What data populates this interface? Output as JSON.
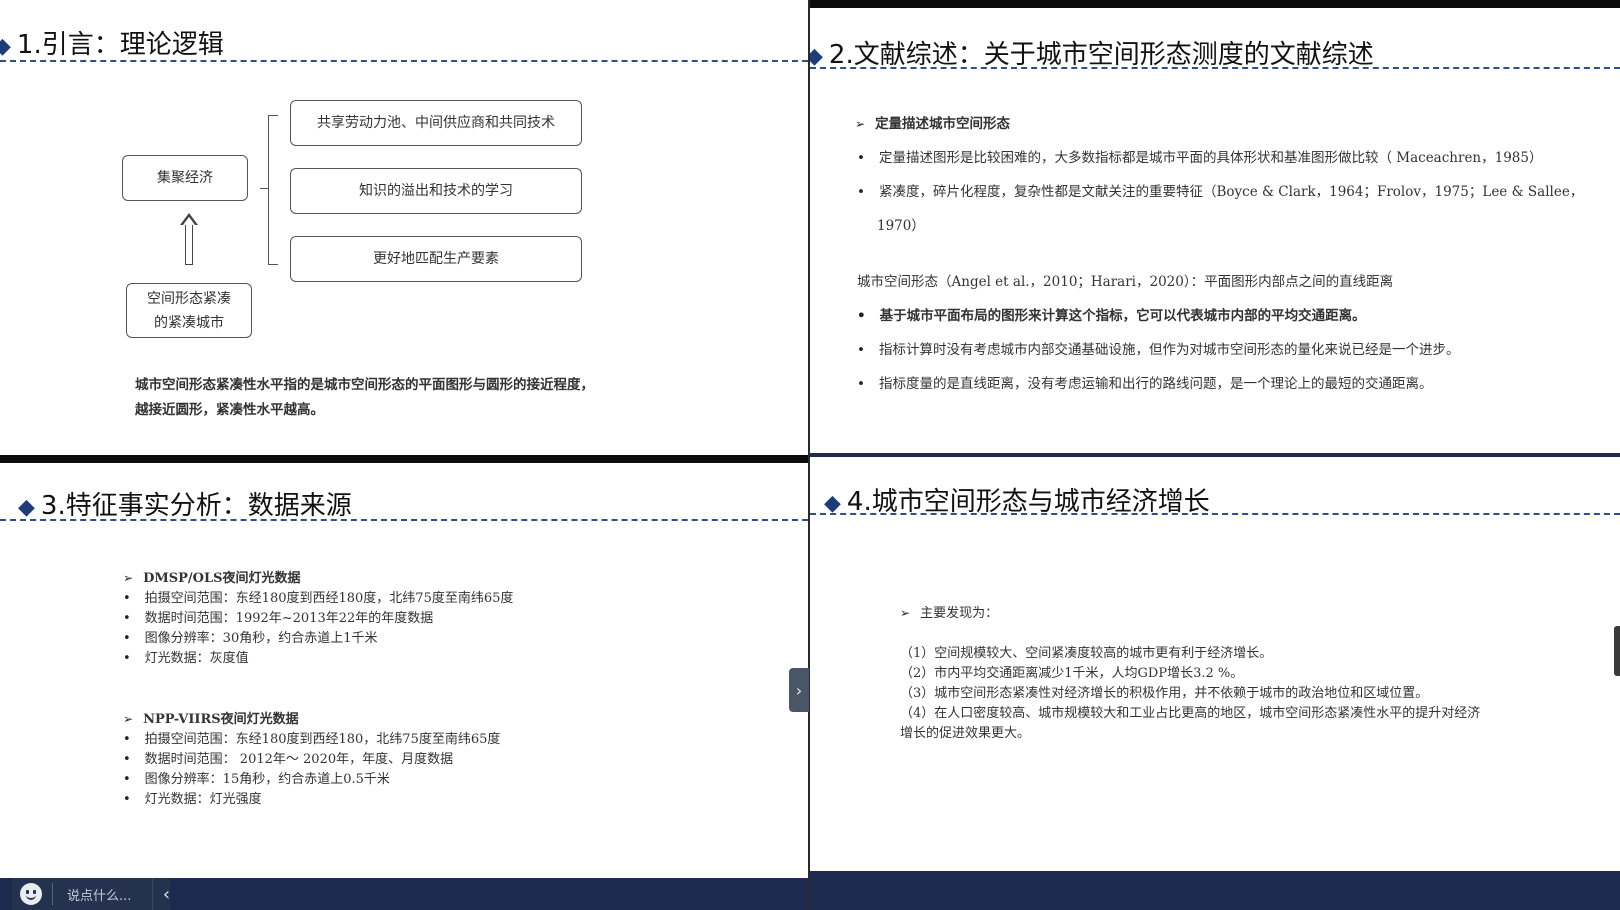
{
  "panel1": {
    "title": "1.引言：理论逻辑",
    "title_prefix": "◆",
    "left_box": "集聚经济",
    "bottom_box_line1": "空间形态紧凑",
    "bottom_box_line2": "的紧凑城市",
    "right_boxes": [
      "共享劳动力池、中间供应商和共同技术",
      "知识的溢出和技术的学习",
      "更好地匹配生产要素"
    ],
    "summary_line1": "城市空间形态紧凑性水平指的是城市空间形态的平面图形与圆形的接近程度，",
    "summary_line2": "越接近圆形，紧凑性水平越高。"
  },
  "panel2": {
    "title": "2.文献综述：关于城市空间形态测度的文献综述",
    "heading": "定量描述城市空间形态",
    "bullets_a": [
      "定量描述图形是比较困难的，大多数指标都是城市平面的具体形状和基准图形做比较（ Maceachren，1985）",
      "紧凑度，碎片化程度，复杂性都是文献关注的重要特征（Boyce & Clark，1964；Frolov，1975；Lee & Sallee，",
      "1970）"
    ],
    "plain": "城市空间形态（Angel et al.，2010；Harari，2020）：平面图形内部点之间的直线距离",
    "bold_bullet": "基于城市平面布局的图形来计算这个指标，它可以代表城市内部的平均交通距离。",
    "bullets_b": [
      "指标计算时没有考虑城市内部交通基础设施，但作为对城市空间形态的量化来说已经是一个进步。",
      "指标度量的是直线距离，没有考虑运输和出行的路线问题，是一个理论上的最短的交通距离。"
    ]
  },
  "panel3": {
    "title": "3.特征事实分析：数据来源",
    "section1": {
      "heading": "DMSP/OLS夜间灯光数据",
      "items": [
        "拍摄空间范围：东经180度到西经180度，北纬75度至南纬65度",
        "数据时间范围：1992年~2013年22年的年度数据",
        "图像分辨率：30角秒，约合赤道上1千米",
        "灯光数据：灰度值"
      ]
    },
    "section2": {
      "heading": "NPP-VIIRS夜间灯光数据",
      "items": [
        "拍摄空间范围：东经180度到西经180，北纬75度至南纬65度",
        "数据时间范围： 2012年～ 2020年，年度、月度数据",
        "图像分辨率：15角秒，约合赤道上0.5千米",
        "灯光数据：灯光强度"
      ]
    }
  },
  "panel4": {
    "title": "4.城市空间形态与城市经济增长",
    "heading": "主要发现为：",
    "findings": [
      "（1）空间规模较大、空间紧凑度较高的城市更有利于经济增长。",
      "（2）市内平均交通距离减少1千米，人均GDP增长3.2 %。",
      "（3）城市空间形态紧凑性对经济增长的积极作用，并不依赖于城市的政治地位和区域位置。",
      "（4）在人口密度较高、城市规模较大和工业占比更高的地区，城市空间形态紧凑性水平的提升对经济",
      "增长的促进效果更大。"
    ]
  },
  "chat": {
    "placeholder": "说点什么...",
    "collapse_icon": "chevron-left-icon"
  },
  "side_tab": {
    "icon": "chevron-right-icon"
  },
  "colors": {
    "accent": "#1f3c7a",
    "bar": "#1b2a4e"
  }
}
